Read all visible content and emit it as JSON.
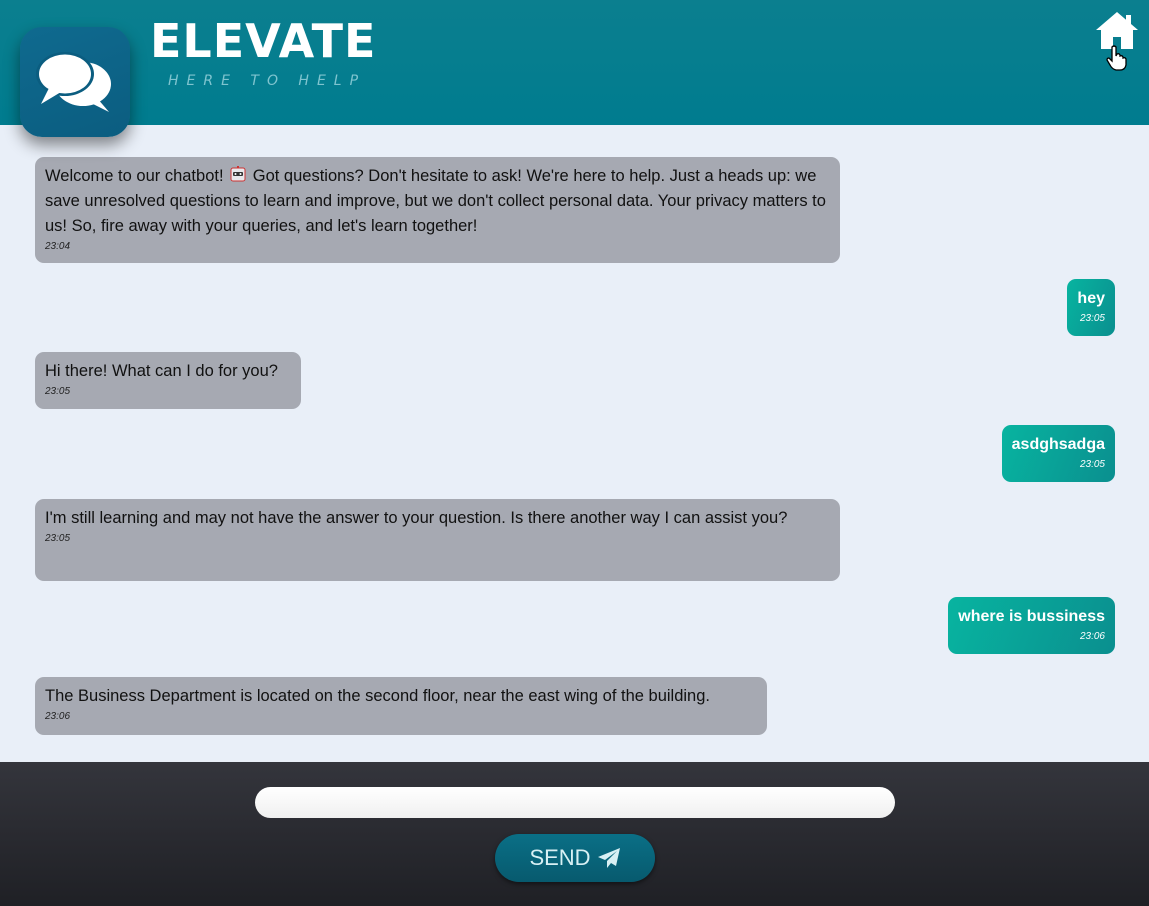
{
  "header": {
    "title": "ELEVATE",
    "tagline": "HERE TO HELP",
    "logo_icon": "chat-bubbles-icon",
    "home_icon": "home-icon",
    "colors": {
      "header_bg": "#007c8f",
      "logo_bg": "#0b5d80"
    }
  },
  "messages": [
    {
      "sender": "bot",
      "text_before": "Welcome to our chatbot!",
      "emoji": "robot-icon",
      "text": "Got questions? Don't hesitate to ask! We're here to help. Just a heads up: we save unresolved questions to learn and improve, but we don't collect personal data. Your privacy matters to us! So, fire away with your queries, and let's learn together!",
      "time": "23:04"
    },
    {
      "sender": "user",
      "text": "hey",
      "time": "23:05"
    },
    {
      "sender": "bot",
      "text": "Hi there! What can I do for you?",
      "time": "23:05"
    },
    {
      "sender": "user",
      "text": "asdghsadga",
      "time": "23:05"
    },
    {
      "sender": "bot",
      "text": "I'm still learning and may not have the answer to your question. Is there another way I can assist you?",
      "time": "23:05"
    },
    {
      "sender": "user",
      "text": "where is bussiness",
      "time": "23:06"
    },
    {
      "sender": "bot",
      "text": "The Business Department is located on the second floor, near the east wing of the building.",
      "time": "23:06"
    }
  ],
  "composer": {
    "input_value": "",
    "input_placeholder": "",
    "send_label": "SEND",
    "send_icon": "paper-plane-icon"
  },
  "colors": {
    "bot_bubble": "#a6a9b2",
    "user_bubble": "#08b4a0",
    "chat_bg": "#e9eff8",
    "footer_bg": "#2a2b31",
    "send_button": "#0a6f86"
  }
}
